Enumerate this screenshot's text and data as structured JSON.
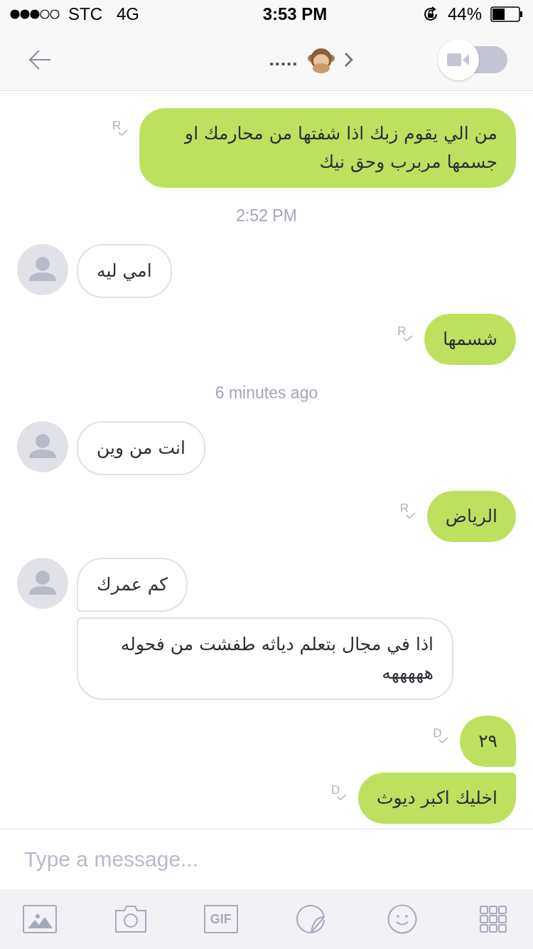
{
  "status_bar": {
    "carrier": "STC",
    "network": "4G",
    "time": "3:53 PM",
    "battery": "44%"
  },
  "header": {
    "title": ".....",
    "video_call": {
      "on": false
    }
  },
  "messages": [
    {
      "kind": "outgoing",
      "text": "من الي يقوم زبك اذا شفتها من محارمك او جسمها مربرب وحق نيك",
      "receipt": "R"
    },
    {
      "kind": "time",
      "text": "2:52 PM"
    },
    {
      "kind": "incoming",
      "text": "امي ليه"
    },
    {
      "kind": "outgoing",
      "text": "شسمها",
      "receipt": "R"
    },
    {
      "kind": "time",
      "text": "6 minutes ago"
    },
    {
      "kind": "incoming",
      "text": "انت من وين"
    },
    {
      "kind": "outgoing",
      "text": "الرياض",
      "receipt": "R"
    },
    {
      "kind": "incoming",
      "text": "كم عمرك"
    },
    {
      "kind": "incoming",
      "text": "اذا في مجال بتعلم دياثه طفشت من فحوله هههههه"
    },
    {
      "kind": "outgoing",
      "text": "٢٩",
      "receipt": "D"
    },
    {
      "kind": "outgoing",
      "text": "اخليك اكبر ديوث",
      "receipt": "D"
    }
  ],
  "composer": {
    "placeholder": "Type a message..."
  },
  "toolbar": [
    {
      "kind": "image"
    },
    {
      "kind": "camera"
    },
    {
      "kind": "gif",
      "label": "GIF"
    },
    {
      "kind": "sticker"
    },
    {
      "kind": "emoji"
    },
    {
      "kind": "apps"
    }
  ]
}
